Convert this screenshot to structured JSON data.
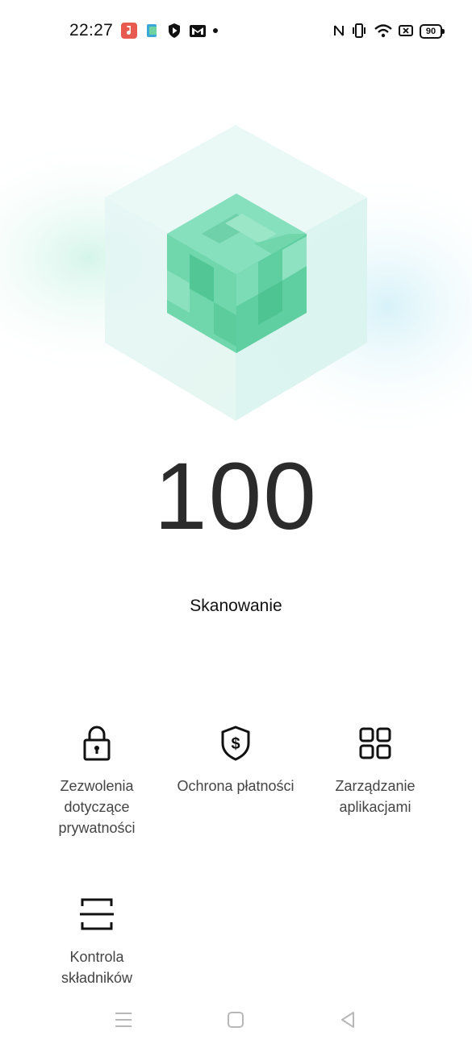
{
  "status_bar": {
    "time": "22:27",
    "battery": "90",
    "notification_icons": [
      "music-app-icon",
      "files-app-icon",
      "play-shield-icon",
      "gmail-icon",
      "dot-icon"
    ],
    "system_icons": [
      "nfc-icon",
      "vibrate-icon",
      "wifi-icon",
      "no-sim-icon",
      "battery-icon"
    ]
  },
  "main": {
    "score": "100",
    "scan_label": "Skanowanie"
  },
  "features": [
    {
      "label_line1": "Zezwolenia",
      "label_line2": "dotyczące",
      "label_line3": "prywatności",
      "icon": "lock-icon"
    },
    {
      "label_line1": "Ochrona płatności",
      "icon": "shield-dollar-icon"
    },
    {
      "label_line1": "Zarządzanie",
      "label_line2": "aplikacjami",
      "icon": "grid-icon"
    },
    {
      "label_line1": "Kontrola",
      "label_line2": "składników",
      "icon": "scan-frame-icon"
    }
  ],
  "colors": {
    "cube_green": "#5fd3a3",
    "cube_light": "#9be6c6",
    "glow": "#d6f5ee"
  }
}
